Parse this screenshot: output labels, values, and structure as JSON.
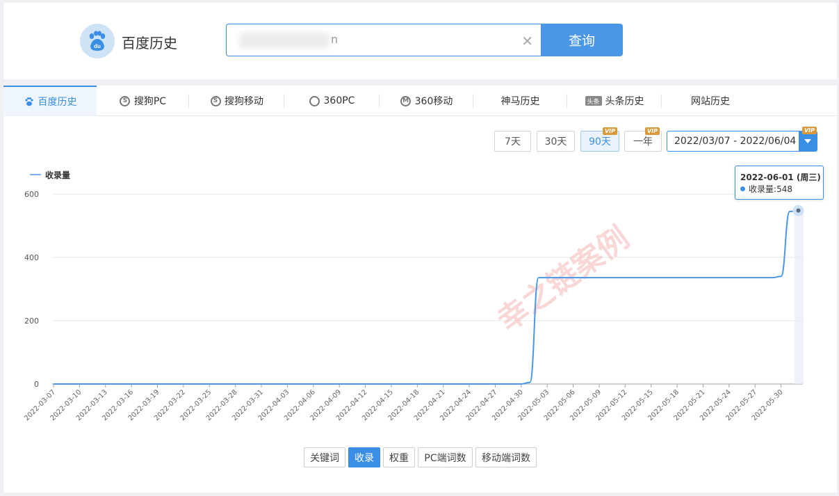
{
  "brand": {
    "title": "百度历史"
  },
  "search": {
    "value_tail": "n",
    "button_label": "查询"
  },
  "tabs": [
    {
      "label": "百度历史",
      "icon": "paw-icon",
      "active": true
    },
    {
      "label": "搜狗PC",
      "icon": "sogou-icon"
    },
    {
      "label": "搜狗移动",
      "icon": "sogou-icon"
    },
    {
      "label": "360PC",
      "icon": "360-icon"
    },
    {
      "label": "360移动",
      "icon": "360-mobile-icon"
    },
    {
      "label": "神马历史",
      "icon": ""
    },
    {
      "label": "头条历史",
      "icon": "toutiao-icon",
      "icon_text": "头条"
    },
    {
      "label": "网站历史",
      "icon": ""
    }
  ],
  "range_buttons": [
    {
      "label": "7天",
      "vip": false,
      "active": false
    },
    {
      "label": "30天",
      "vip": false,
      "active": false
    },
    {
      "label": "90天",
      "vip": true,
      "active": true
    },
    {
      "label": "一年",
      "vip": true,
      "active": false
    }
  ],
  "vip_badge": "VIP",
  "date_range": "2022/03/07 - 2022/06/04",
  "tooltip": {
    "title": "2022-06-01 (周三)",
    "series": "收录量",
    "value": "548"
  },
  "watermark": "幸之链案例",
  "metric_buttons": [
    {
      "label": "关键词",
      "active": false
    },
    {
      "label": "收录",
      "active": true
    },
    {
      "label": "权重",
      "active": false
    },
    {
      "label": "PC端词数",
      "active": false
    },
    {
      "label": "移动端词数",
      "active": false
    }
  ],
  "colors": {
    "accent": "#3a8ee6",
    "line": "#4a97e8",
    "vip": "#d99a3d"
  },
  "chart_data": {
    "type": "line",
    "title": "",
    "xlabel": "",
    "ylabel": "",
    "ylim": [
      0,
      600
    ],
    "yticks": [
      0,
      200,
      400,
      600
    ],
    "grid": true,
    "legend": "top-left",
    "x_tick_labels": [
      "2022-03-07",
      "2022-03-10",
      "2022-03-13",
      "2022-03-16",
      "2022-03-19",
      "2022-03-22",
      "2022-03-25",
      "2022-03-28",
      "2022-03-31",
      "2022-04-03",
      "2022-04-06",
      "2022-04-09",
      "2022-04-12",
      "2022-04-15",
      "2022-04-18",
      "2022-04-21",
      "2022-04-24",
      "2022-04-27",
      "2022-04-30",
      "2022-05-03",
      "2022-05-06",
      "2022-05-09",
      "2022-05-12",
      "2022-05-15",
      "2022-05-18",
      "2022-05-21",
      "2022-05-24",
      "2022-05-27",
      "2022-05-30"
    ],
    "series": [
      {
        "name": "收录量",
        "points": [
          [
            "2022-03-07",
            0
          ],
          [
            "2022-04-30",
            0
          ],
          [
            "2022-05-01",
            5
          ],
          [
            "2022-05-02",
            336
          ],
          [
            "2022-05-29",
            336
          ],
          [
            "2022-05-30",
            340
          ],
          [
            "2022-05-31",
            545
          ],
          [
            "2022-06-01",
            548
          ]
        ]
      }
    ]
  }
}
